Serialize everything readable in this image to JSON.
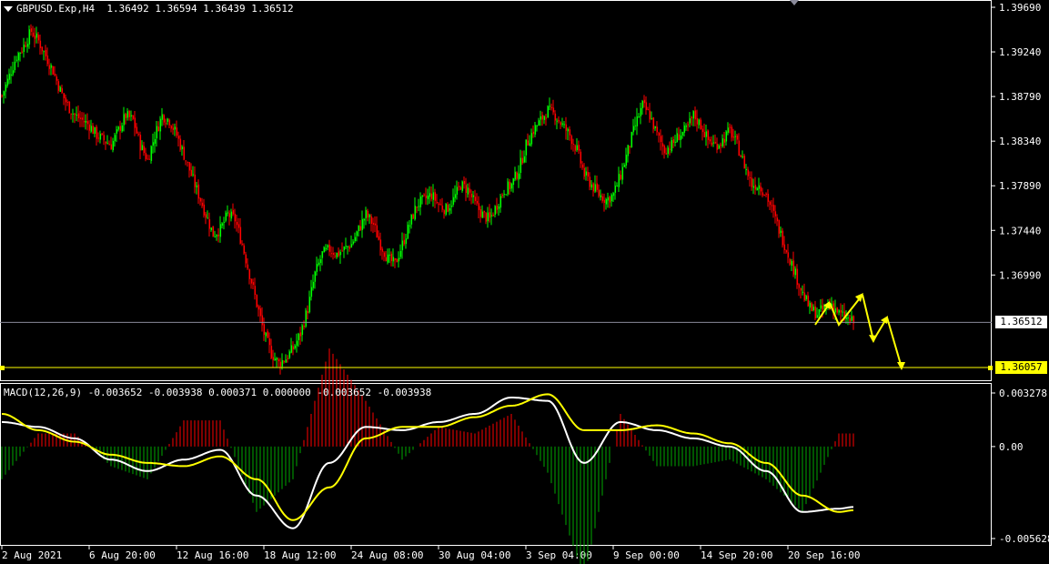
{
  "header": {
    "symbol_timeframe": "GBPUSD.Exp,H4",
    "ohlc": "1.36492 1.36594 1.36439 1.36512"
  },
  "indicator": {
    "label": "MACD(12,26,9) -0.003652 -0.003938 0.000371 0.000000 -0.003652 -0.003938"
  },
  "price_tags": {
    "current": "1.36512",
    "level": "1.36057"
  },
  "colors": {
    "background": "#000000",
    "bull_candle": "#00ff00",
    "bear_candle": "#ff0000",
    "macd_line": "#ffffff",
    "signal_line": "#ffff00",
    "hist_positive": "#ff0000",
    "hist_negative": "#00aa00",
    "level_line": "#ffff00",
    "grid_axis": "#ffffff",
    "projection_arrows": "#ffff00"
  },
  "chart_data": [
    {
      "type": "candlestick",
      "title": "GBPUSD.Exp,H4",
      "ylim": [
        1.3562,
        1.3973
      ],
      "y_ticks": [
        "1.39690",
        "1.39240",
        "1.38790",
        "1.38340",
        "1.37890",
        "1.37440",
        "1.36990"
      ],
      "x_ticks": [
        "2 Aug 2021",
        "6 Aug 20:00",
        "12 Aug 16:00",
        "18 Aug 12:00",
        "24 Aug 08:00",
        "30 Aug 04:00",
        "3 Sep 04:00",
        "9 Sep 00:00",
        "14 Sep 20:00",
        "20 Sep 16:00"
      ],
      "close_path": [
        [
          0,
          1.388
        ],
        [
          4,
          1.39
        ],
        [
          8,
          1.392
        ],
        [
          12,
          1.393
        ],
        [
          16,
          1.3945
        ],
        [
          20,
          1.3935
        ],
        [
          24,
          1.392
        ],
        [
          28,
          1.3905
        ],
        [
          32,
          1.3885
        ],
        [
          36,
          1.387
        ],
        [
          40,
          1.386
        ],
        [
          44,
          1.3855
        ],
        [
          48,
          1.385
        ],
        [
          52,
          1.384
        ],
        [
          56,
          1.3835
        ],
        [
          60,
          1.383
        ],
        [
          64,
          1.3845
        ],
        [
          68,
          1.386
        ],
        [
          72,
          1.3855
        ],
        [
          76,
          1.383
        ],
        [
          80,
          1.3815
        ],
        [
          84,
          1.384
        ],
        [
          88,
          1.386
        ],
        [
          92,
          1.3855
        ],
        [
          96,
          1.384
        ],
        [
          100,
          1.382
        ],
        [
          104,
          1.38
        ],
        [
          108,
          1.378
        ],
        [
          112,
          1.376
        ],
        [
          116,
          1.374
        ],
        [
          120,
          1.3745
        ],
        [
          124,
          1.376
        ],
        [
          128,
          1.3755
        ],
        [
          132,
          1.373
        ],
        [
          136,
          1.37
        ],
        [
          140,
          1.367
        ],
        [
          144,
          1.364
        ],
        [
          148,
          1.362
        ],
        [
          152,
          1.361
        ],
        [
          156,
          1.3615
        ],
        [
          160,
          1.3625
        ],
        [
          164,
          1.364
        ],
        [
          168,
          1.3665
        ],
        [
          172,
          1.37
        ],
        [
          176,
          1.372
        ],
        [
          180,
          1.3725
        ],
        [
          184,
          1.372
        ],
        [
          188,
          1.3725
        ],
        [
          192,
          1.373
        ],
        [
          196,
          1.3745
        ],
        [
          200,
          1.376
        ],
        [
          204,
          1.375
        ],
        [
          208,
          1.373
        ],
        [
          212,
          1.3715
        ],
        [
          216,
          1.371
        ],
        [
          220,
          1.373
        ],
        [
          224,
          1.375
        ],
        [
          228,
          1.377
        ],
        [
          232,
          1.3775
        ],
        [
          236,
          1.378
        ],
        [
          240,
          1.377
        ],
        [
          244,
          1.3765
        ],
        [
          248,
          1.3775
        ],
        [
          252,
          1.379
        ],
        [
          256,
          1.3785
        ],
        [
          260,
          1.377
        ],
        [
          264,
          1.376
        ],
        [
          268,
          1.3755
        ],
        [
          272,
          1.377
        ],
        [
          276,
          1.3785
        ],
        [
          280,
          1.379
        ],
        [
          284,
          1.3805
        ],
        [
          288,
          1.383
        ],
        [
          292,
          1.3845
        ],
        [
          296,
          1.3855
        ],
        [
          300,
          1.3865
        ],
        [
          304,
          1.386
        ],
        [
          308,
          1.385
        ],
        [
          312,
          1.384
        ],
        [
          316,
          1.3825
        ],
        [
          320,
          1.38
        ],
        [
          324,
          1.379
        ],
        [
          328,
          1.378
        ],
        [
          332,
          1.3775
        ],
        [
          336,
          1.378
        ],
        [
          340,
          1.38
        ],
        [
          344,
          1.3825
        ],
        [
          348,
          1.385
        ],
        [
          352,
          1.387
        ],
        [
          356,
          1.386
        ],
        [
          360,
          1.384
        ],
        [
          364,
          1.3825
        ],
        [
          368,
          1.383
        ],
        [
          372,
          1.384
        ],
        [
          376,
          1.3845
        ],
        [
          380,
          1.386
        ],
        [
          384,
          1.385
        ],
        [
          388,
          1.3835
        ],
        [
          392,
          1.383
        ],
        [
          396,
          1.3835
        ],
        [
          400,
          1.3845
        ],
        [
          404,
          1.383
        ],
        [
          408,
          1.381
        ],
        [
          412,
          1.379
        ],
        [
          416,
          1.379
        ],
        [
          420,
          1.378
        ],
        [
          424,
          1.376
        ],
        [
          428,
          1.374
        ],
        [
          432,
          1.372
        ],
        [
          436,
          1.37
        ],
        [
          440,
          1.368
        ],
        [
          444,
          1.3665
        ],
        [
          448,
          1.366
        ],
        [
          452,
          1.3665
        ],
        [
          456,
          1.367
        ],
        [
          460,
          1.366
        ],
        [
          464,
          1.3655
        ],
        [
          468,
          1.3651
        ]
      ]
    },
    {
      "type": "line",
      "title": "MACD(12,26,9)",
      "ylim": [
        -0.0059,
        0.0035
      ],
      "y_ticks": [
        "0.003278",
        "0.00",
        "-0.005628"
      ],
      "x": [
        0,
        20,
        40,
        60,
        80,
        100,
        120,
        140,
        160,
        180,
        200,
        220,
        240,
        260,
        280,
        300,
        320,
        340,
        360,
        380,
        400,
        420,
        440,
        460,
        468
      ],
      "series": [
        {
          "name": "MACD",
          "values": [
            0.0015,
            0.0012,
            0.0005,
            -0.0008,
            -0.0015,
            -0.0008,
            -0.0002,
            -0.003,
            -0.005,
            -0.001,
            0.0012,
            0.001,
            0.0015,
            0.002,
            0.003,
            0.0028,
            -0.001,
            0.0015,
            0.001,
            0.0005,
            0.0,
            -0.0015,
            -0.004,
            -0.0038,
            -0.0037
          ]
        },
        {
          "name": "Signal",
          "values": [
            0.002,
            0.001,
            0.0003,
            -0.0005,
            -0.001,
            -0.0012,
            -0.0006,
            -0.002,
            -0.0045,
            -0.0025,
            0.0005,
            0.0012,
            0.0012,
            0.0018,
            0.0025,
            0.0032,
            0.001,
            0.001,
            0.0013,
            0.0008,
            0.0002,
            -0.001,
            -0.003,
            -0.004,
            -0.0039
          ]
        }
      ]
    }
  ]
}
